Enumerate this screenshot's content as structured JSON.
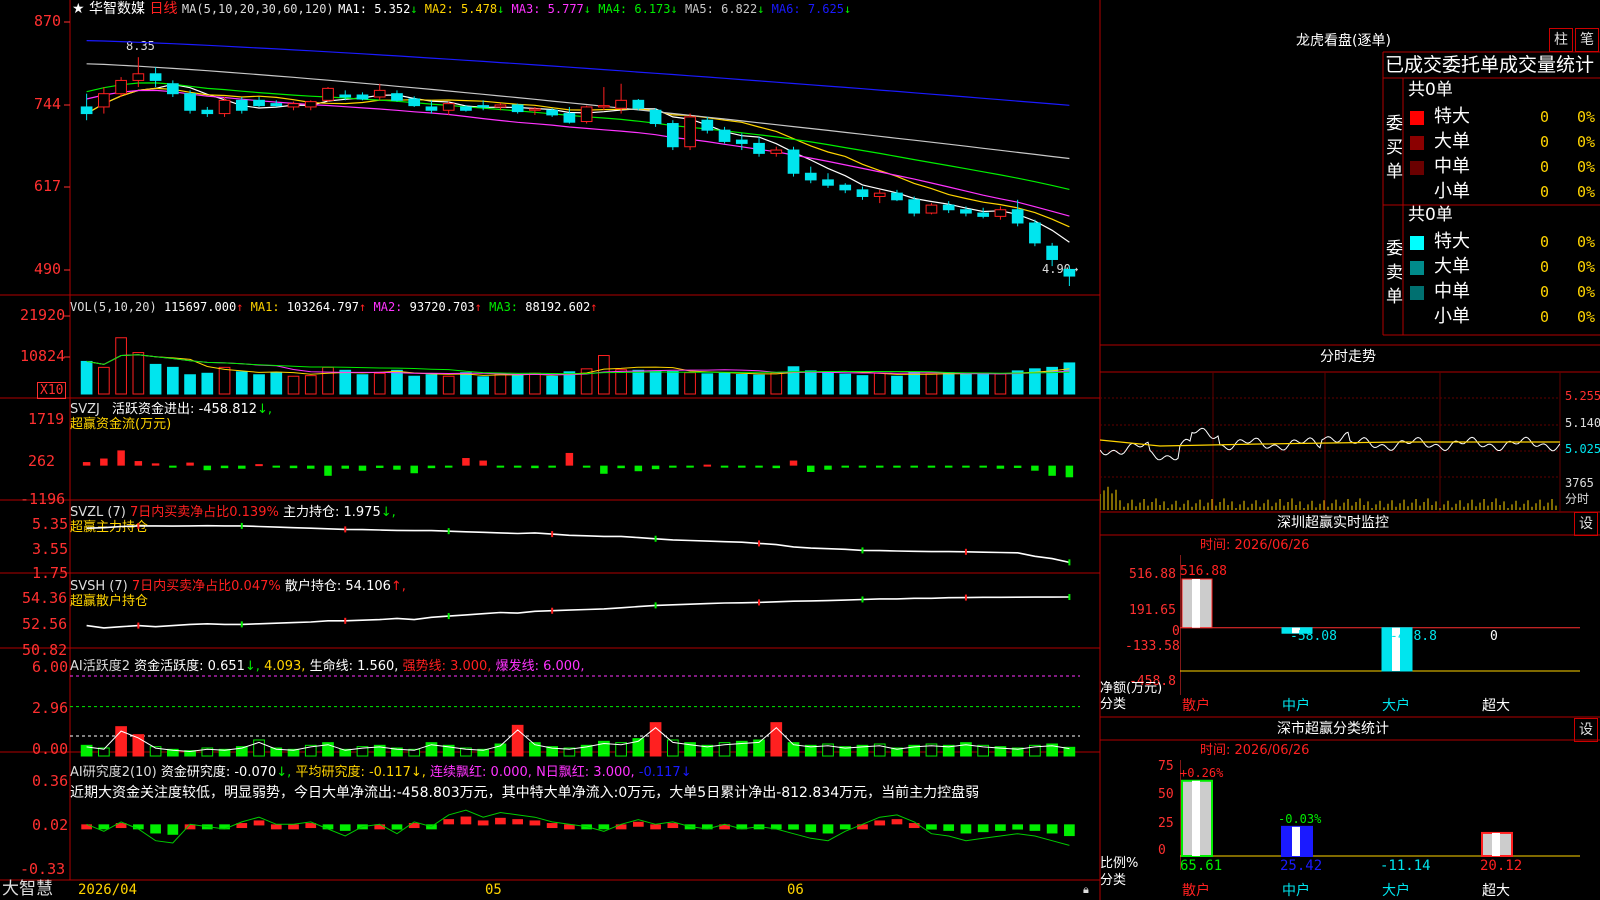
{
  "colors": {
    "up": "#ff2020",
    "down": "#00e5ee",
    "grid": "#b00000",
    "axis": "#ff3030",
    "ma1": "#ffffff",
    "ma2": "#ffd400",
    "ma3": "#ff33ff",
    "ma4": "#00ee00",
    "ma5": "#c8c8c8",
    "ma6": "#1a1aff",
    "vol_ma1": "#ffd400",
    "vol_ma2": "#ff33ff",
    "vol_ma3": "#00ee00"
  },
  "k_panel": {
    "star": "★",
    "name": "华智数媒",
    "period": "日线",
    "ma_params": "MA(5,10,20,30,60,120)",
    "ma": [
      {
        "label": "MA1:",
        "value": "5.352",
        "arrow": "↓"
      },
      {
        "label": "MA2:",
        "value": "5.478",
        "arrow": "↓"
      },
      {
        "label": "MA3:",
        "value": "5.777",
        "arrow": "↓"
      },
      {
        "label": "MA4:",
        "value": "6.173",
        "arrow": "↓"
      },
      {
        "label": "MA5:",
        "value": "6.822",
        "arrow": "↓"
      },
      {
        "label": "MA6:",
        "value": "7.625",
        "arrow": "↓"
      }
    ],
    "y_ticks": [
      "870",
      "744",
      "617",
      "490"
    ],
    "high_label": "8.35",
    "low_label": "4.90→"
  },
  "vol_panel": {
    "params": "VOL(5,10,20)",
    "value": "115697.000",
    "arrow": "↑",
    "ma": [
      {
        "label": "MA1:",
        "value": "103264.797",
        "arrow": "↑"
      },
      {
        "label": "MA2:",
        "value": "93720.703",
        "arrow": "↑"
      },
      {
        "label": "MA3:",
        "value": "88192.602",
        "arrow": "↑"
      }
    ],
    "y_ticks": [
      "21920",
      "10824"
    ],
    "unit": "X10"
  },
  "svzj_panel": {
    "code": "SVZJ",
    "label": "活跃资金进出:",
    "value": "-458.812",
    "arrow": "↓,",
    "subtitle": "超赢资金流(万元)",
    "y_ticks": [
      "1719",
      "262",
      "-1196"
    ]
  },
  "svzl_panel": {
    "code": "SVZL (7)",
    "pct_label": "7日内买卖净占比0.139%",
    "hold_label": "主力持仓:",
    "hold_value": "1.975",
    "arrow": "↓,",
    "subtitle": "超赢主力持仓",
    "y_ticks": [
      "5.35",
      "3.55",
      "1.75"
    ]
  },
  "svsh_panel": {
    "code": "SVSH (7)",
    "pct_label": "7日内买卖净占比0.047%",
    "hold_label": "散户持仓:",
    "hold_value": "54.106",
    "arrow": "↑,",
    "subtitle": "超赢散户持仓",
    "y_ticks": [
      "54.36",
      "52.56",
      "50.82"
    ]
  },
  "ai_active_panel": {
    "title": "AI活跃度2",
    "label": "资金活跃度:",
    "value": "0.651",
    "arrow": "↓,",
    "value2": "4.093,",
    "life": "生命线: 1.560,",
    "strong": "强势线: 3.000,",
    "burst": "爆发线: 6.000,",
    "y_ticks": [
      "6.00",
      "2.96",
      "0.00"
    ]
  },
  "ai_research_panel": {
    "title": "AI研究度2(10)",
    "label": "资金研究度:",
    "value": "-0.070",
    "arrow": "↓,",
    "avg": "平均研究度: -0.117↓,",
    "red": "连续飘红: 0.000,",
    "nred": "N日飘红: 3.000,",
    "tail": "-0.117↓",
    "comment": "近期大资金关注度较低，明显弱势，今日大单净流出:-458.803万元，其中特大单净流入:0万元，大单5日累计净出-812.834万元，当前主力控盘弱",
    "y_ticks": [
      "0.36",
      "0.02",
      "-0.33"
    ]
  },
  "x_axis": {
    "brand": "大智慧",
    "dates": [
      "2026/04",
      "05",
      "06"
    ]
  },
  "dragon": {
    "title": "龙虎看盘(逐单)",
    "btn_bar": "柱",
    "btn_pen": "笔",
    "header": "已成交委托单成交量统计",
    "buy": {
      "side": "委买单",
      "total": "共0单",
      "rows": [
        {
          "name": "特大",
          "count": "0",
          "pct": "0%",
          "color": "#ff0000"
        },
        {
          "name": "大单",
          "count": "0",
          "pct": "0%",
          "color": "#8b0000"
        },
        {
          "name": "中单",
          "count": "0",
          "pct": "0%",
          "color": "#6a0000"
        },
        {
          "name": "小单",
          "count": "0",
          "pct": "0%",
          "color": "#000000"
        }
      ]
    },
    "sell": {
      "side": "委卖单",
      "total": "共0单",
      "rows": [
        {
          "name": "特大",
          "count": "0",
          "pct": "0%",
          "color": "#00ffff"
        },
        {
          "name": "大单",
          "count": "0",
          "pct": "0%",
          "color": "#008b8b"
        },
        {
          "name": "中单",
          "count": "0",
          "pct": "0%",
          "color": "#007070"
        },
        {
          "name": "小单",
          "count": "0",
          "pct": "0%",
          "color": "#000000"
        }
      ]
    }
  },
  "intraday": {
    "title": "分时走势",
    "prices": [
      "5.255",
      "5.140",
      "5.025"
    ],
    "vol": "3765",
    "vol_unit": "分时"
  },
  "monitor": {
    "title": "深圳超赢实时监控",
    "btn": "设",
    "time": "时间: 2026/06/26",
    "y_ticks": [
      "516.88",
      "191.65",
      "0",
      "-133.58",
      "-458.8"
    ],
    "values": [
      {
        "cat": "散户",
        "value": 516.88,
        "label": "516.88"
      },
      {
        "cat": "中户",
        "value": -58.08,
        "label": "-58.08"
      },
      {
        "cat": "大户",
        "value": -458.8,
        "label": "-458.8"
      },
      {
        "cat": "超大",
        "value": 0,
        "label": "0"
      }
    ],
    "ylabel": "净额(万元)",
    "xlabel": "分类"
  },
  "classify": {
    "title": "深市超赢分类统计",
    "btn": "设",
    "time": "时间: 2026/06/26",
    "y_ticks": [
      "75",
      "50",
      "25",
      "0"
    ],
    "bars": [
      {
        "cat": "散户",
        "value": 65.61,
        "label": "65.61",
        "delta": "+0.26%"
      },
      {
        "cat": "中户",
        "value": 25.42,
        "label": "25.42",
        "delta": "-0.03%"
      },
      {
        "cat": "大户",
        "value": -11.14,
        "label": "-11.14",
        "delta": ""
      },
      {
        "cat": "超大",
        "value": 20.12,
        "label": "20.12",
        "delta": ""
      }
    ],
    "ylabel": "比例%",
    "xlabel": "分类"
  },
  "chart_data": [
    {
      "type": "candlestick",
      "title": "华智数媒 日线",
      "ma": {
        "MA1": 5.352,
        "MA2": 5.478,
        "MA3": 5.777,
        "MA4": 6.173,
        "MA5": 6.822,
        "MA6": 7.625
      },
      "ylim": [
        4.9,
        8.7
      ],
      "y_ticks": [
        8.7,
        7.44,
        6.17,
        4.9
      ],
      "ohlc": [
        [
          7.6,
          7.8,
          7.4,
          7.5
        ],
        [
          7.6,
          7.9,
          7.5,
          7.8
        ],
        [
          7.8,
          8.05,
          7.75,
          8.0
        ],
        [
          8.0,
          8.35,
          7.9,
          8.1
        ],
        [
          8.1,
          8.2,
          7.9,
          8.0
        ],
        [
          7.95,
          8.0,
          7.75,
          7.8
        ],
        [
          7.8,
          7.85,
          7.5,
          7.55
        ],
        [
          7.55,
          7.6,
          7.45,
          7.5
        ],
        [
          7.5,
          7.75,
          7.45,
          7.7
        ],
        [
          7.7,
          7.75,
          7.5,
          7.55
        ],
        [
          7.7,
          7.75,
          7.6,
          7.62
        ],
        [
          7.65,
          7.7,
          7.6,
          7.62
        ],
        [
          7.6,
          7.68,
          7.55,
          7.65
        ],
        [
          7.6,
          7.7,
          7.55,
          7.68
        ],
        [
          7.7,
          7.9,
          7.68,
          7.88
        ],
        [
          7.78,
          7.85,
          7.7,
          7.75
        ],
        [
          7.78,
          7.82,
          7.7,
          7.72
        ],
        [
          7.75,
          7.95,
          7.7,
          7.85
        ],
        [
          7.8,
          7.85,
          7.68,
          7.7
        ],
        [
          7.72,
          7.76,
          7.6,
          7.62
        ],
        [
          7.6,
          7.7,
          7.5,
          7.55
        ],
        [
          7.55,
          7.68,
          7.48,
          7.65
        ],
        [
          7.6,
          7.63,
          7.53,
          7.55
        ],
        [
          7.62,
          7.7,
          7.55,
          7.6
        ],
        [
          7.6,
          7.66,
          7.55,
          7.63
        ],
        [
          7.63,
          7.65,
          7.5,
          7.53
        ],
        [
          7.55,
          7.6,
          7.48,
          7.57
        ],
        [
          7.55,
          7.58,
          7.45,
          7.48
        ],
        [
          7.5,
          7.6,
          7.35,
          7.37
        ],
        [
          7.38,
          7.62,
          7.35,
          7.6
        ],
        [
          7.6,
          7.9,
          7.55,
          7.62
        ],
        [
          7.58,
          7.95,
          7.5,
          7.7
        ],
        [
          7.7,
          7.72,
          7.55,
          7.58
        ],
        [
          7.55,
          7.58,
          7.3,
          7.35
        ],
        [
          7.35,
          7.4,
          6.95,
          7.0
        ],
        [
          7.0,
          7.5,
          6.95,
          7.45
        ],
        [
          7.4,
          7.45,
          7.2,
          7.25
        ],
        [
          7.25,
          7.3,
          7.05,
          7.08
        ],
        [
          7.1,
          7.2,
          6.95,
          7.05
        ],
        [
          7.05,
          7.15,
          6.85,
          6.9
        ],
        [
          6.9,
          7.0,
          6.85,
          6.95
        ],
        [
          6.95,
          7.0,
          6.55,
          6.6
        ],
        [
          6.6,
          6.7,
          6.45,
          6.5
        ],
        [
          6.5,
          6.6,
          6.38,
          6.42
        ],
        [
          6.42,
          6.45,
          6.3,
          6.35
        ],
        [
          6.35,
          6.4,
          6.2,
          6.25
        ],
        [
          6.25,
          6.35,
          6.15,
          6.3
        ],
        [
          6.3,
          6.35,
          6.18,
          6.2
        ],
        [
          6.2,
          6.25,
          5.95,
          6.0
        ],
        [
          6.0,
          6.15,
          5.98,
          6.12
        ],
        [
          6.12,
          6.18,
          6.0,
          6.05
        ],
        [
          6.05,
          6.1,
          5.95,
          6.0
        ],
        [
          6.0,
          6.08,
          5.92,
          5.95
        ],
        [
          5.95,
          6.1,
          5.9,
          6.05
        ],
        [
          6.05,
          6.2,
          5.8,
          5.85
        ],
        [
          5.85,
          5.9,
          5.5,
          5.55
        ],
        [
          5.5,
          5.55,
          5.2,
          5.3
        ],
        [
          5.15,
          5.2,
          4.9,
          5.05
        ]
      ]
    },
    {
      "type": "bar",
      "title": "VOL(5,10,20)",
      "ylim": [
        0,
        25000
      ],
      "y_ticks": [
        21920,
        10824
      ],
      "values": [
        11000,
        9000,
        19000,
        14000,
        10000,
        9000,
        6500,
        7000,
        9000,
        7500,
        6500,
        7200,
        6000,
        6200,
        9000,
        8000,
        6500,
        7000,
        8000,
        6000,
        6500,
        6000,
        7200,
        5800,
        6800,
        6400,
        7000,
        6000,
        7500,
        8500,
        13000,
        8200,
        8000,
        7800,
        7600,
        7200,
        6800,
        7000,
        6600,
        6400,
        7200,
        9200,
        7800,
        7200,
        6700,
        6200,
        7000,
        6000,
        7500,
        6800,
        7200,
        6600,
        7000,
        6800,
        7800,
        8500,
        9000,
        10500
      ]
    },
    {
      "type": "bar",
      "title": "SVZJ 活跃资金进出",
      "ylim": [
        -1196,
        1719
      ],
      "y_ticks": [
        1719,
        262,
        -1196
      ],
      "values": [
        140,
        280,
        600,
        180,
        90,
        -80,
        120,
        -180,
        -100,
        -120,
        60,
        -60,
        -100,
        -120,
        -400,
        -120,
        -200,
        -90,
        -160,
        -300,
        -100,
        -50,
        300,
        200,
        -40,
        -60,
        -100,
        -80,
        500,
        -60,
        -320,
        -100,
        -220,
        -140,
        -80,
        -60,
        40,
        -40,
        -80,
        -60,
        -100,
        200,
        -250,
        -160,
        -40,
        -30,
        -20,
        -30,
        -60,
        -80,
        -40,
        -30,
        -60,
        -120,
        -90,
        -200,
        -400,
        -459
      ]
    },
    {
      "type": "line",
      "title": "SVZL 主力持仓",
      "ylim": [
        1.75,
        5.35
      ],
      "y_ticks": [
        5.35,
        3.55,
        1.75
      ],
      "values": [
        4.9,
        4.95,
        5.05,
        5.1,
        5.1,
        5.08,
        5.1,
        5.12,
        5.1,
        5.1,
        5.05,
        5.0,
        4.95,
        4.9,
        4.85,
        4.8,
        4.78,
        4.75,
        4.72,
        4.7,
        4.7,
        4.65,
        4.6,
        4.55,
        4.5,
        4.45,
        4.5,
        4.4,
        4.3,
        4.25,
        4.2,
        4.2,
        4.1,
        4.0,
        3.9,
        3.85,
        3.8,
        3.75,
        3.7,
        3.6,
        3.5,
        3.3,
        3.2,
        3.15,
        3.1,
        3.0,
        2.98,
        2.95,
        2.92,
        2.9,
        2.9,
        2.88,
        2.85,
        2.82,
        2.8,
        2.5,
        2.3,
        1.975
      ]
    },
    {
      "type": "line",
      "title": "SVSH 散户持仓",
      "ylim": [
        50.82,
        54.36
      ],
      "y_ticks": [
        54.36,
        52.56,
        50.82
      ],
      "values": [
        51.7,
        51.5,
        51.6,
        51.7,
        51.6,
        51.7,
        51.8,
        51.85,
        51.8,
        51.8,
        51.85,
        51.9,
        51.95,
        52.0,
        52.1,
        52.1,
        52.15,
        52.2,
        52.3,
        52.2,
        52.4,
        52.5,
        52.6,
        52.7,
        52.8,
        52.75,
        52.9,
        52.95,
        53.0,
        53.05,
        53.1,
        53.2,
        53.3,
        53.4,
        53.45,
        53.5,
        53.55,
        53.6,
        53.62,
        53.65,
        53.7,
        53.75,
        53.78,
        53.8,
        53.85,
        53.9,
        53.95,
        53.95,
        54.0,
        54.0,
        54.05,
        54.06,
        54.08,
        54.08,
        54.09,
        54.1,
        54.1,
        54.106
      ]
    },
    {
      "type": "bar",
      "title": "AI活跃度2",
      "ylim": [
        0,
        6
      ],
      "y_ticks": [
        6.0,
        2.96,
        0.0
      ],
      "values": [
        0.8,
        0.6,
        2.2,
        1.6,
        0.7,
        0.5,
        0.4,
        0.6,
        0.5,
        0.7,
        1.2,
        0.6,
        0.5,
        0.8,
        1.0,
        0.5,
        0.7,
        0.8,
        0.6,
        0.5,
        1.0,
        0.8,
        0.6,
        0.5,
        0.9,
        2.3,
        1.0,
        0.7,
        0.6,
        0.8,
        1.1,
        1.0,
        1.3,
        2.5,
        1.2,
        1.0,
        0.8,
        1.0,
        1.1,
        1.2,
        2.5,
        1.0,
        0.8,
        0.9,
        0.7,
        0.8,
        0.9,
        0.6,
        0.8,
        0.9,
        0.8,
        1.0,
        0.8,
        0.7,
        0.6,
        0.8,
        0.9,
        0.651
      ]
    },
    {
      "type": "bar",
      "title": "AI研究度2(10)",
      "ylim": [
        -0.33,
        0.36
      ],
      "y_ticks": [
        0.36,
        0.02,
        -0.33
      ],
      "values": [
        0.02,
        -0.01,
        0.03,
        0.0,
        -0.05,
        -0.06,
        0.02,
        0.01,
        0.0,
        0.03,
        0.05,
        0.02,
        0.02,
        0.03,
        0.0,
        -0.03,
        0.01,
        0.02,
        -0.02,
        0.03,
        0.01,
        0.06,
        0.08,
        0.05,
        0.07,
        0.06,
        0.05,
        0.03,
        0.02,
        0.01,
        -0.01,
        0.02,
        0.04,
        0.02,
        0.03,
        0.01,
        0.0,
        0.02,
        0.0,
        0.01,
        0.0,
        -0.02,
        -0.04,
        -0.05,
        -0.01,
        0.02,
        0.05,
        0.06,
        0.03,
        -0.02,
        -0.03,
        -0.05,
        -0.04,
        -0.03,
        -0.02,
        -0.03,
        -0.05,
        -0.07
      ]
    }
  ]
}
